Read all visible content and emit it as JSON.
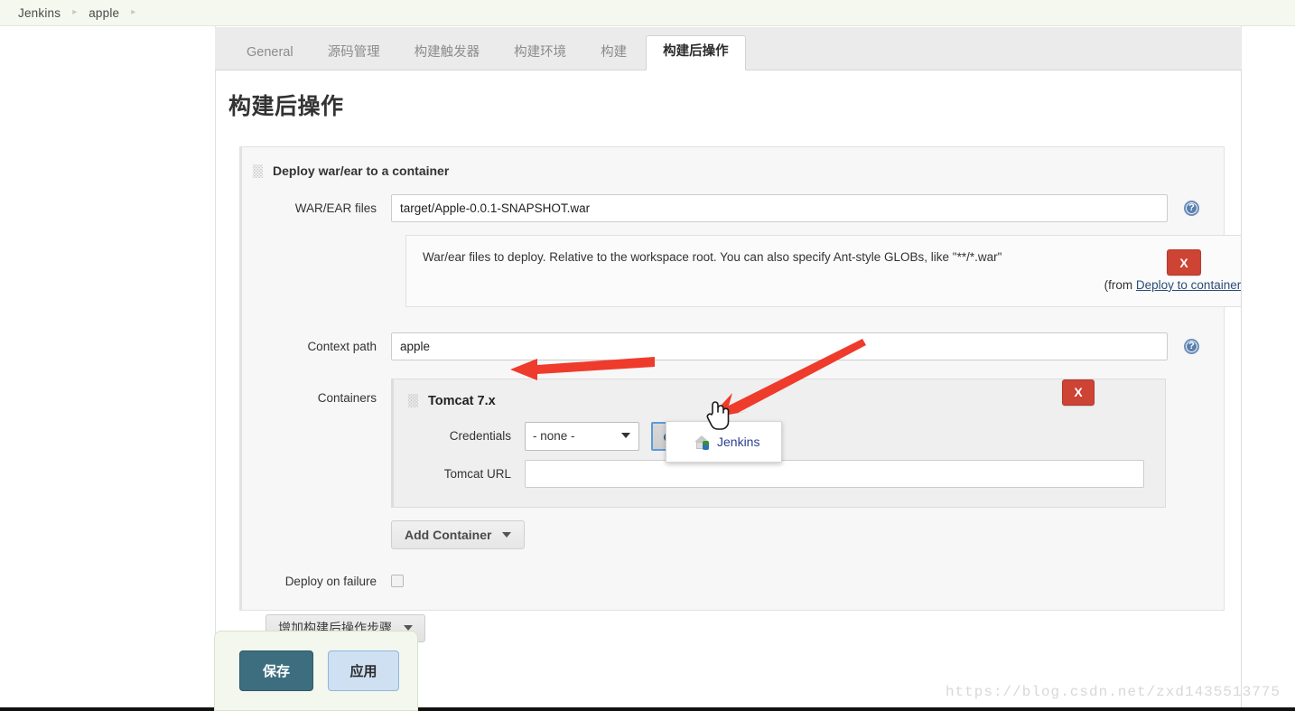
{
  "breadcrumb": {
    "items": [
      {
        "label": "Jenkins"
      },
      {
        "label": "apple"
      }
    ],
    "separator": "▸"
  },
  "tabs": [
    {
      "label": "General",
      "active": false
    },
    {
      "label": "源码管理",
      "active": false
    },
    {
      "label": "构建触发器",
      "active": false
    },
    {
      "label": "构建环境",
      "active": false
    },
    {
      "label": "构建",
      "active": false
    },
    {
      "label": "构建后操作",
      "active": true
    }
  ],
  "page": {
    "title": "构建后操作"
  },
  "post_build": {
    "block_title": "Deploy war/ear to a container",
    "remove_label": "X",
    "war_ear": {
      "label": "WAR/EAR files",
      "value": "target/Apple-0.0.1-SNAPSHOT.war",
      "placeholder": ""
    },
    "war_ear_help": {
      "text": "War/ear files to deploy. Relative to the workspace root. You can also specify Ant-style GLOBs, like \"**/*.war\"",
      "from_prefix": "(from ",
      "link": "Deploy to container Plugin",
      "from_suffix": ")"
    },
    "context_path": {
      "label": "Context path",
      "value": "apple",
      "placeholder": ""
    },
    "containers": {
      "label": "Containers",
      "remove_label": "X",
      "container_title": "Tomcat 7.x",
      "credentials": {
        "label": "Credentials",
        "selected": "- none -",
        "options": [
          "- none -"
        ]
      },
      "add_button": {
        "label": "Add"
      },
      "add_menu": {
        "items": [
          {
            "label": "Jenkins"
          }
        ]
      },
      "tomcat_url": {
        "label": "Tomcat URL",
        "value": "",
        "placeholder": ""
      },
      "add_container_button": "Add Container"
    },
    "deploy_on_failure": {
      "label": "Deploy on failure",
      "checked": false
    },
    "add_step_button": "增加构建后操作步骤"
  },
  "footer": {
    "save_label": "保存",
    "apply_label": "应用"
  },
  "watermark": "https://blog.csdn.net/zxd1435513775",
  "colors": {
    "accent_red": "#cd4334",
    "save_teal": "#3c6e7f",
    "apply_blue": "#cfe0f2",
    "link_blue": "#2c4d78",
    "annotation_red": "#ee3b2c"
  }
}
